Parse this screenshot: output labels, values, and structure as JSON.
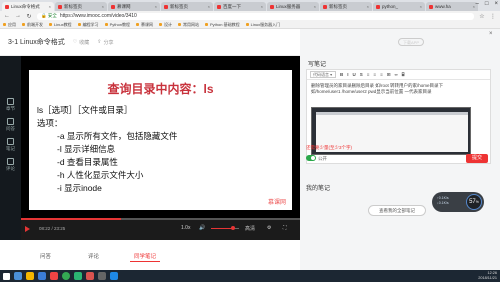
{
  "browser": {
    "tabs": [
      {
        "label": "Linux命令格式",
        "active": true
      },
      {
        "label": "新标签页"
      },
      {
        "label": "慕课网"
      },
      {
        "label": "新标签页"
      },
      {
        "label": "百度一下"
      },
      {
        "label": "Linux服务器"
      },
      {
        "label": "新标签页"
      },
      {
        "label": "python_"
      },
      {
        "label": "www.ha"
      }
    ],
    "url": "https://www.imooc.com/video/3410",
    "secure_label": "安全",
    "bookmarks": [
      "应用",
      "前端开发",
      "Linux教程",
      "编程学习",
      "Python教程",
      "慕课网",
      "设计",
      "常用网站",
      "Python 基础教程",
      "Linux服务器入门"
    ]
  },
  "header": {
    "title": "3-1 Linux命令格式",
    "collect_label": "收藏",
    "share_label": "分享"
  },
  "sidebar": {
    "items": [
      "章节",
      "问答",
      "笔记",
      "评论"
    ]
  },
  "slide": {
    "title": "查询目录中内容：ls",
    "lines": [
      "ls［选项］［文件或目录］",
      "选项：",
      "-a    显示所有文件，包括隐藏文件",
      "-l     显示详细信息",
      "-d    查看目录属性",
      "-h    人性化显示文件大小",
      "-i     显示inode"
    ],
    "watermark": "慕课网"
  },
  "player": {
    "time": "08:22 / 23:25",
    "progress": 0.36,
    "volume": 0.8,
    "quality_label": "高清",
    "speed_label": "1.0x"
  },
  "below_tabs": [
    {
      "label": "问答"
    },
    {
      "label": "评论"
    },
    {
      "label": "同学笔记",
      "active": true
    }
  ],
  "notes": {
    "heading": "写笔记",
    "download_label": "下载APP",
    "toolbar_select": "代码语言",
    "toolbar_buttons": [
      "B",
      "I",
      "U",
      "S",
      "≡",
      "≡",
      "≡",
      "⊞",
      "∞",
      "⌸"
    ],
    "text_line1": "删除管理员的家目录删除后目录 如/root 转转用户的家/home目录下",
    "text_line2": "如/home/user1 /home/user2        pwd显示当前位置 一代表家目录",
    "hint": "还需要少量(至少3个字)",
    "publish_label": "公开",
    "submit_label": "提交",
    "my_notes_heading": "我的笔记",
    "view_all_label": "查看我的全部笔记"
  },
  "widget": {
    "value": "57",
    "unit": "%",
    "line1": "0.1K/s",
    "line2": "0.1K/s"
  },
  "tray": {
    "time": "12:26",
    "date": "2018/11/21"
  }
}
